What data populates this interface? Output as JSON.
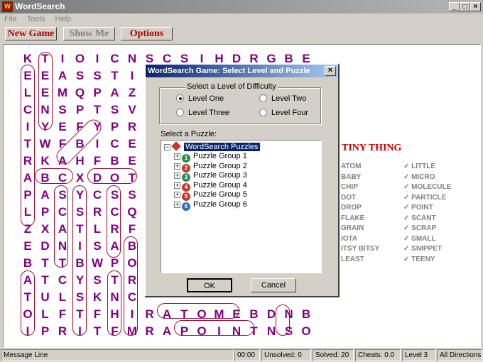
{
  "window": {
    "title": "WordSearch",
    "icon": "wordsearch-app-icon"
  },
  "menu": [
    "File",
    "Tools",
    "Help"
  ],
  "toolbar": {
    "new_game": "New Game",
    "show_me": "Show Me",
    "options": "Options"
  },
  "grid_rows": [
    "KTIOICNSCSIHDRGBE",
    "EEASSTI",
    "LEMQPAZI",
    "CNSPTSVI",
    "IYEFYPRI",
    "TWFBICE",
    "RKAHFBE",
    "ABCXDOT",
    "PASYCSS",
    "LPCSRCQ",
    "ZXATLRF",
    "EDNISAB",
    "BTTBWPO",
    "ATCYSTR",
    "TULSKNC",
    "OLFTFHIRATOMEBDNB",
    "IPRITFMRAPOINTNSO"
  ],
  "puzzle": {
    "title": "TINY THING",
    "words_left": [
      "ATOM",
      "BABY",
      "CHIP",
      "DOT",
      "DROP",
      "FLAKE",
      "GRAIN",
      "IOTA",
      "ITSY BITSY",
      "LEAST"
    ],
    "words_right": [
      "✓ LITTLE",
      "✓ MICRO",
      "✓ MOLECULE",
      "✓ PARTICLE",
      "✓ POINT",
      "✓ SCANT",
      "✓ SCRAP",
      "✓ SMALL",
      "✓ SNIPPET",
      "✓ TEENY"
    ]
  },
  "status": {
    "message": "Message Line",
    "time": "00:00",
    "unsolved": "Unsolved:  0",
    "solved": "Solved:  20",
    "cheats": "Cheats:  0.0",
    "level": "Level  3",
    "mode": "All Directions"
  },
  "dialog": {
    "title": "WordSearch Game:  Select Level and Puzzle",
    "difficulty_label": "Select a Level of Difficulty",
    "levels": [
      "Level One",
      "Level Two",
      "Level Three",
      "Level Four"
    ],
    "selected_level": "Level One",
    "puzzle_label": "Select a Puzzle:",
    "tree_root": "WordSearch Puzzles",
    "groups": [
      "Puzzle Group 1",
      "Puzzle Group 2",
      "Puzzle Group 3",
      "Puzzle Group 4",
      "Puzzle Group 5",
      "Puzzle Group 6"
    ],
    "group_numbers": [
      "1",
      "2",
      "3",
      "4",
      "5",
      "6"
    ],
    "ok": "OK",
    "cancel": "Cancel"
  },
  "colors": {
    "letters": "#800080",
    "rings": "#9b1030",
    "title_red": "#c00000",
    "dialog_title": "#0a246a"
  }
}
